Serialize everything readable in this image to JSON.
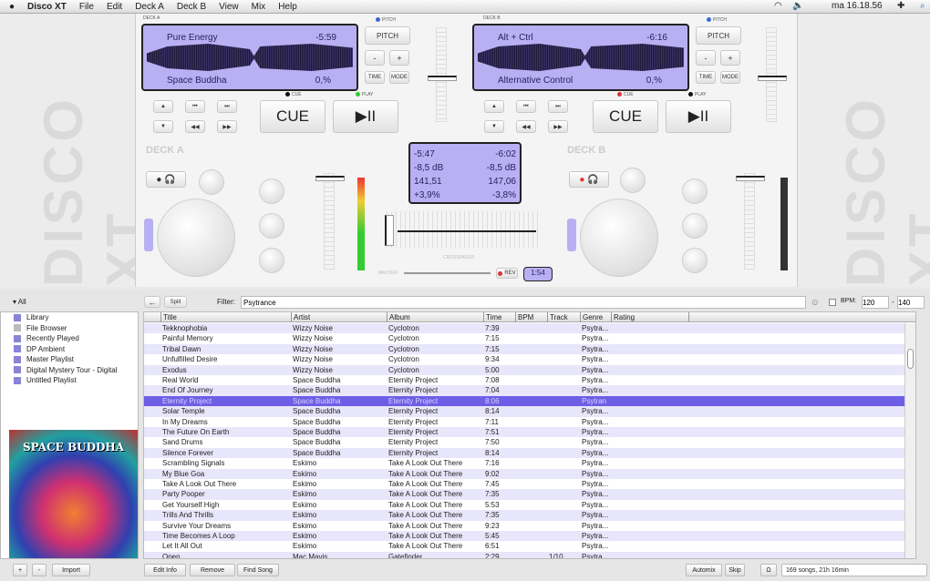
{
  "menubar": {
    "app": "Disco XT",
    "items": [
      "File",
      "Edit",
      "Deck A",
      "Deck B",
      "View",
      "Mix",
      "Help"
    ],
    "clock": "ma 16.18.56"
  },
  "watermark": "DISCO XT",
  "deck_a": {
    "label": "DECK A",
    "title": "Pure Energy",
    "time": "-5:59",
    "artist": "Space Buddha",
    "pitch": "0,%",
    "pitch_label": "PITCH",
    "minus": "-",
    "plus": "+",
    "time_btn": "TIME",
    "mode_btn": "MODE",
    "cue": "CUE",
    "play": "▶II",
    "cue_ind": "CUE",
    "play_ind": "PLAY",
    "name": "DECK A"
  },
  "deck_b": {
    "label": "DECK B",
    "title": "Alt + Ctrl",
    "time": "-6:16",
    "artist": "Alternative Control",
    "pitch": "0,%",
    "pitch_label": "PITCH",
    "minus": "-",
    "plus": "+",
    "time_btn": "TIME",
    "mode_btn": "MODE",
    "cue": "CUE",
    "play": "▶II",
    "cue_ind": "CUE",
    "play_ind": "PLAY",
    "name": "DECK B"
  },
  "center": {
    "a": [
      "-5:47",
      "-8,5 dB",
      "141,51",
      "+3,9%"
    ],
    "b": [
      "-6:02",
      "-8,5 dB",
      "147,06",
      "-3,8%"
    ],
    "rev": "REV",
    "timer": "1:54",
    "crossfader": "CROSSFADER",
    "master": "MASTER"
  },
  "library": {
    "root": "All",
    "back": "←",
    "split": "Split",
    "filter_label": "Filter:",
    "filter": "Psytrance",
    "bpm_label": "BPM:",
    "bpm_min": "120",
    "bpm_sep": "-",
    "bpm_max": "140",
    "playlists": [
      "Library",
      "File Browser",
      "Recently Played",
      "DP Ambient",
      "Master Playlist",
      "Digital Mystery Tour - Digital",
      "Untitled Playlist"
    ],
    "album_art": "SPACE BUDDHA",
    "columns": [
      "Title",
      "Artist",
      "Album",
      "Time",
      "BPM",
      "Track",
      "Genre",
      "Rating"
    ],
    "rows": [
      [
        "Tekknophobia",
        "Wizzy Noise",
        "Cyclotron",
        "7:39",
        "",
        "",
        "Psytra..."
      ],
      [
        "Painful Memory",
        "Wizzy Noise",
        "Cyclotron",
        "7:15",
        "",
        "",
        "Psytra..."
      ],
      [
        "Tribal Dawn",
        "Wizzy Noise",
        "Cyclotron",
        "7:15",
        "",
        "",
        "Psytra..."
      ],
      [
        "Unfulfilled Desire",
        "Wizzy Noise",
        "Cyclotron",
        "9:34",
        "",
        "",
        "Psytra..."
      ],
      [
        "Exodus",
        "Wizzy Noise",
        "Cyclotron",
        "5:00",
        "",
        "",
        "Psytra..."
      ],
      [
        "Real World",
        "Space Buddha",
        "Eternity Project",
        "7:08",
        "",
        "",
        "Psytra..."
      ],
      [
        "End Of Journey",
        "Space Buddha",
        "Eternity Project",
        "7:04",
        "",
        "",
        "Psytra..."
      ],
      [
        "Eternity Project",
        "Space Buddha",
        "Eternity Project",
        "8:06",
        "",
        "",
        "Psytran"
      ],
      [
        "Solar Temple",
        "Space Buddha",
        "Eternity Project",
        "8:14",
        "",
        "",
        "Psytra..."
      ],
      [
        "In My Dreams",
        "Space Buddha",
        "Eternity Project",
        "7:11",
        "",
        "",
        "Psytra..."
      ],
      [
        "The Future On Earth",
        "Space Buddha",
        "Eternity Project",
        "7:51",
        "",
        "",
        "Psytra..."
      ],
      [
        "Sand Drums",
        "Space Buddha",
        "Eternity Project",
        "7:50",
        "",
        "",
        "Psytra..."
      ],
      [
        "Silence Forever",
        "Space Buddha",
        "Eternity Project",
        "8:14",
        "",
        "",
        "Psytra..."
      ],
      [
        "Scrambling Signals",
        "Eskimo",
        "Take A Look Out There",
        "7:16",
        "",
        "",
        "Psytra..."
      ],
      [
        "My Blue Goa",
        "Eskimo",
        "Take A Look Out There",
        "9:02",
        "",
        "",
        "Psytra..."
      ],
      [
        "Take A Look Out There",
        "Eskimo",
        "Take A Look Out There",
        "7:45",
        "",
        "",
        "Psytra..."
      ],
      [
        "Party Pooper",
        "Eskimo",
        "Take A Look Out There",
        "7:35",
        "",
        "",
        "Psytra..."
      ],
      [
        "Get Yourself High",
        "Eskimo",
        "Take A Look Out There",
        "5:53",
        "",
        "",
        "Psytra..."
      ],
      [
        "Trills And Thrills",
        "Eskimo",
        "Take A Look Out There",
        "7:35",
        "",
        "",
        "Psytra..."
      ],
      [
        "Survive Your Dreams",
        "Eskimo",
        "Take A Look Out There",
        "9:23",
        "",
        "",
        "Psytra..."
      ],
      [
        "Time Becomes A Loop",
        "Eskimo",
        "Take A Look Out There",
        "5:45",
        "",
        "",
        "Psytra..."
      ],
      [
        "Let It All Out",
        "Eskimo",
        "Take A Look Out There",
        "6:51",
        "",
        "",
        "Psytra..."
      ],
      [
        "Open",
        "Mac Mavis",
        "Gatefinder",
        "2:29",
        "",
        "1/10",
        "Psytra..."
      ]
    ],
    "selected_row": 7
  },
  "bottom": {
    "add": "+",
    "remove_pl": "-",
    "import": "Import",
    "edit_info": "Edit Info",
    "remove": "Remove",
    "find_song": "Find Song",
    "automix": "Automix",
    "skip": "Skip",
    "status": "169 songs, 21h 16min"
  },
  "colors": {
    "display": "#b8b0f2",
    "selection": "#6e5ee6",
    "stripe": "#e8e6fa"
  }
}
